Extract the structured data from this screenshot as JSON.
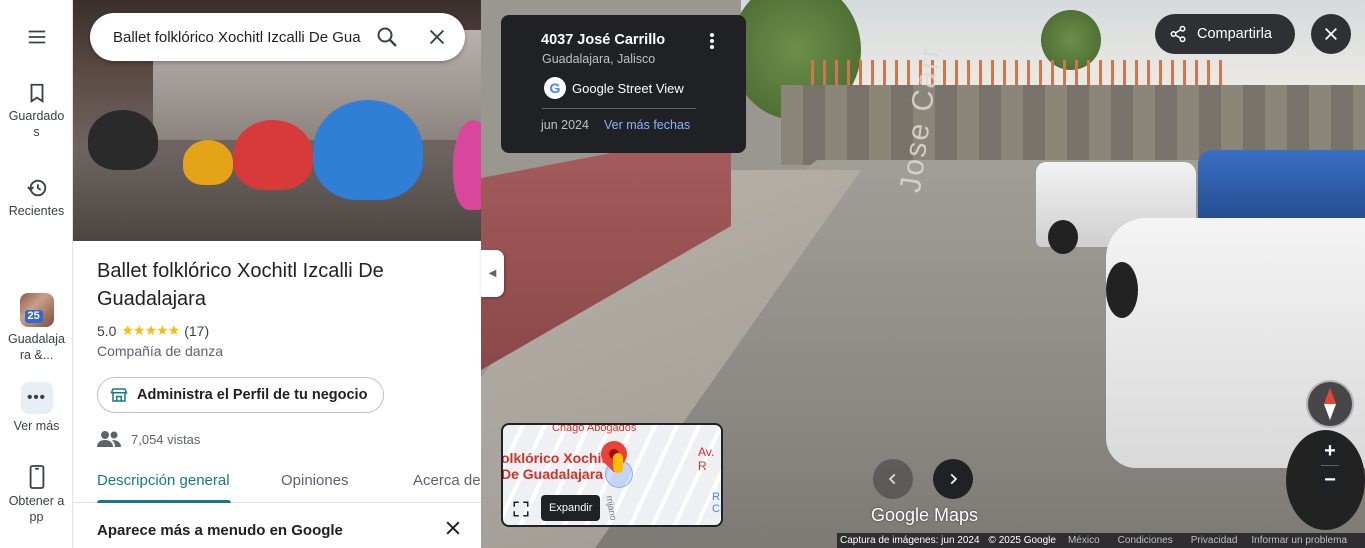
{
  "rail": {
    "saved_label": "Guardados",
    "recent_label": "Recientes",
    "recent_place_badge": "25",
    "recent_place_label": "Guadalajara &...",
    "more_label": "Ver más",
    "get_app_label": "Obtener app"
  },
  "search": {
    "value": "Ballet folklórico Xochitl Izcalli De Guadalajara"
  },
  "place": {
    "title": "Ballet folklórico Xochitl Izcalli De Guadalajara",
    "rating": "5.0",
    "stars": "★★★★★",
    "reviews": "(17)",
    "category": "Compañía de danza",
    "manage_button": "Administra el Perfil de tu negocio",
    "views": "7,054 vistas"
  },
  "tabs": [
    {
      "label": "Descripción general",
      "active": true
    },
    {
      "label": "Opiniones",
      "active": false
    },
    {
      "label": "Acerca de",
      "active": false
    }
  ],
  "section": {
    "title": "Aparece más a menudo en Google"
  },
  "street_view": {
    "address": "4037 José Carrillo",
    "city": "Guadalajara, Jalisco",
    "source": "Google Street View",
    "date": "jun 2024",
    "more_dates": "Ver más fechas",
    "share_label": "Compartirla",
    "road_text": "Jose Carr",
    "logo_text": "Google Maps"
  },
  "minimap": {
    "place_line1": "olklórico Xochitl",
    "place_line2": "De Guadalajara",
    "chago": "Chago Abogados",
    "av": "Av. R",
    "right_label_1": "R",
    "right_label_2": "CH",
    "street_label": "rrijano",
    "expand_tooltip": "Expandir"
  },
  "footer": {
    "capture": "Captura de imágenes: jun 2024",
    "copyright": "© 2025 Google",
    "country": "México",
    "terms": "Condiciones",
    "privacy": "Privacidad",
    "report": "Informar un problema"
  },
  "colors": {
    "accent": "#127a8a",
    "star": "#fbbc04",
    "link_blue": "#8ab4f8"
  }
}
